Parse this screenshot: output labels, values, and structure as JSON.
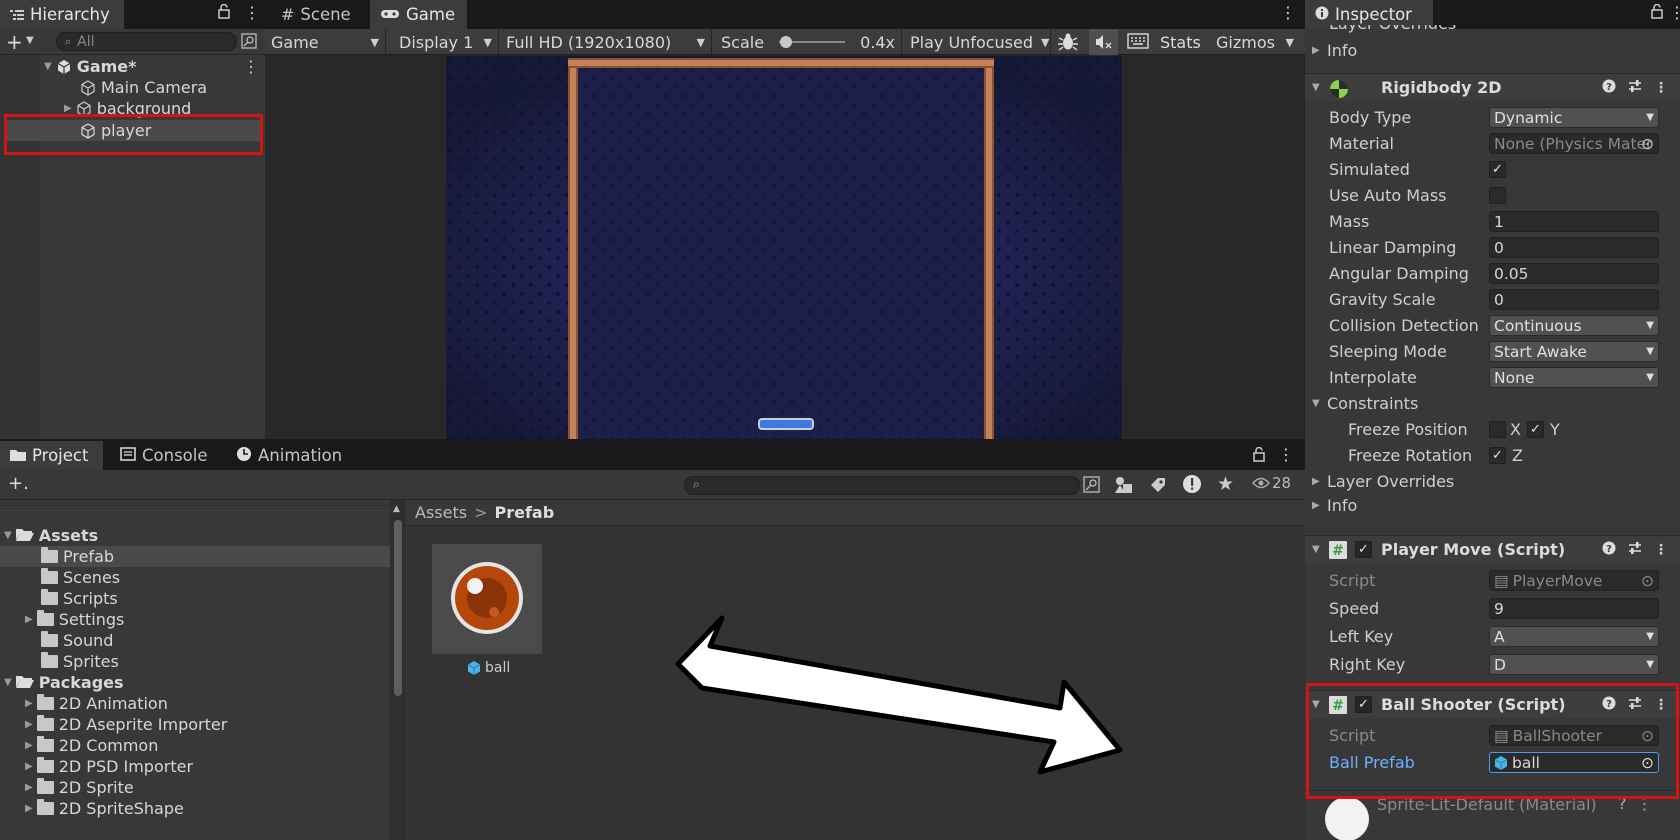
{
  "hierarchy": {
    "tab_label": "Hierarchy",
    "search_placeholder": "All",
    "scene_name": "Game*",
    "items": [
      "Main Camera",
      "background",
      "player"
    ]
  },
  "game_view": {
    "tabs": [
      "Scene",
      "Game"
    ],
    "toolbar": {
      "view_mode": "Game",
      "display": "Display 1",
      "resolution": "Full HD (1920x1080)",
      "scale_label": "Scale",
      "scale_value": "0.4x",
      "play_mode": "Play Unfocused",
      "stats": "Stats",
      "gizmos": "Gizmos"
    }
  },
  "project": {
    "tabs": [
      "Project",
      "Console",
      "Animation"
    ],
    "hidden_count": "28",
    "breadcrumb": [
      "Assets",
      "Prefab"
    ],
    "tree": {
      "assets_label": "Assets",
      "asset_folders": [
        "Prefab",
        "Scenes",
        "Scripts",
        "Settings",
        "Sound",
        "Sprites"
      ],
      "packages_label": "Packages",
      "package_folders": [
        "2D Animation",
        "2D Aseprite Importer",
        "2D Common",
        "2D PSD Importer",
        "2D Sprite",
        "2D SpriteShape"
      ]
    },
    "asset_item": "ball"
  },
  "inspector": {
    "tab_label": "Inspector",
    "top_partial": "Layer Overrides",
    "info_label": "Info",
    "rigidbody": {
      "title": "Rigidbody 2D",
      "rows": [
        {
          "label": "Body Type",
          "value": "Dynamic"
        },
        {
          "label": "Material",
          "value": "None (Physics Mater"
        },
        {
          "label": "Simulated",
          "value": ""
        },
        {
          "label": "Use Auto Mass",
          "value": ""
        },
        {
          "label": "Mass",
          "value": "1"
        },
        {
          "label": "Linear Damping",
          "value": "0"
        },
        {
          "label": "Angular Damping",
          "value": "0.05"
        },
        {
          "label": "Gravity Scale",
          "value": "0"
        },
        {
          "label": "Collision Detection",
          "value": "Continuous"
        },
        {
          "label": "Sleeping Mode",
          "value": "Start Awake"
        },
        {
          "label": "Interpolate",
          "value": "None"
        }
      ],
      "constraints_label": "Constraints",
      "freeze_position": "Freeze Position",
      "freeze_rotation": "Freeze Rotation",
      "x_label": "X",
      "y_label": "Y",
      "z_label": "Z",
      "layer_overrides": "Layer Overrides",
      "info": "Info"
    },
    "player_move": {
      "title": "Player Move (Script)",
      "script_label": "Script",
      "script_value": "PlayerMove",
      "speed_label": "Speed",
      "speed_value": "9",
      "left_key_label": "Left Key",
      "left_key_value": "A",
      "right_key_label": "Right Key",
      "right_key_value": "D"
    },
    "ball_shooter": {
      "title": "Ball Shooter (Script)",
      "script_label": "Script",
      "script_value": "BallShooter",
      "prefab_label": "Ball Prefab",
      "prefab_value": "ball"
    },
    "material_partial": "Sprite-Lit-Default (Material)"
  },
  "colors": {
    "highlight": "#d11414",
    "accent_blue": "#4c9be8",
    "ball_brown": "#b5470a"
  }
}
